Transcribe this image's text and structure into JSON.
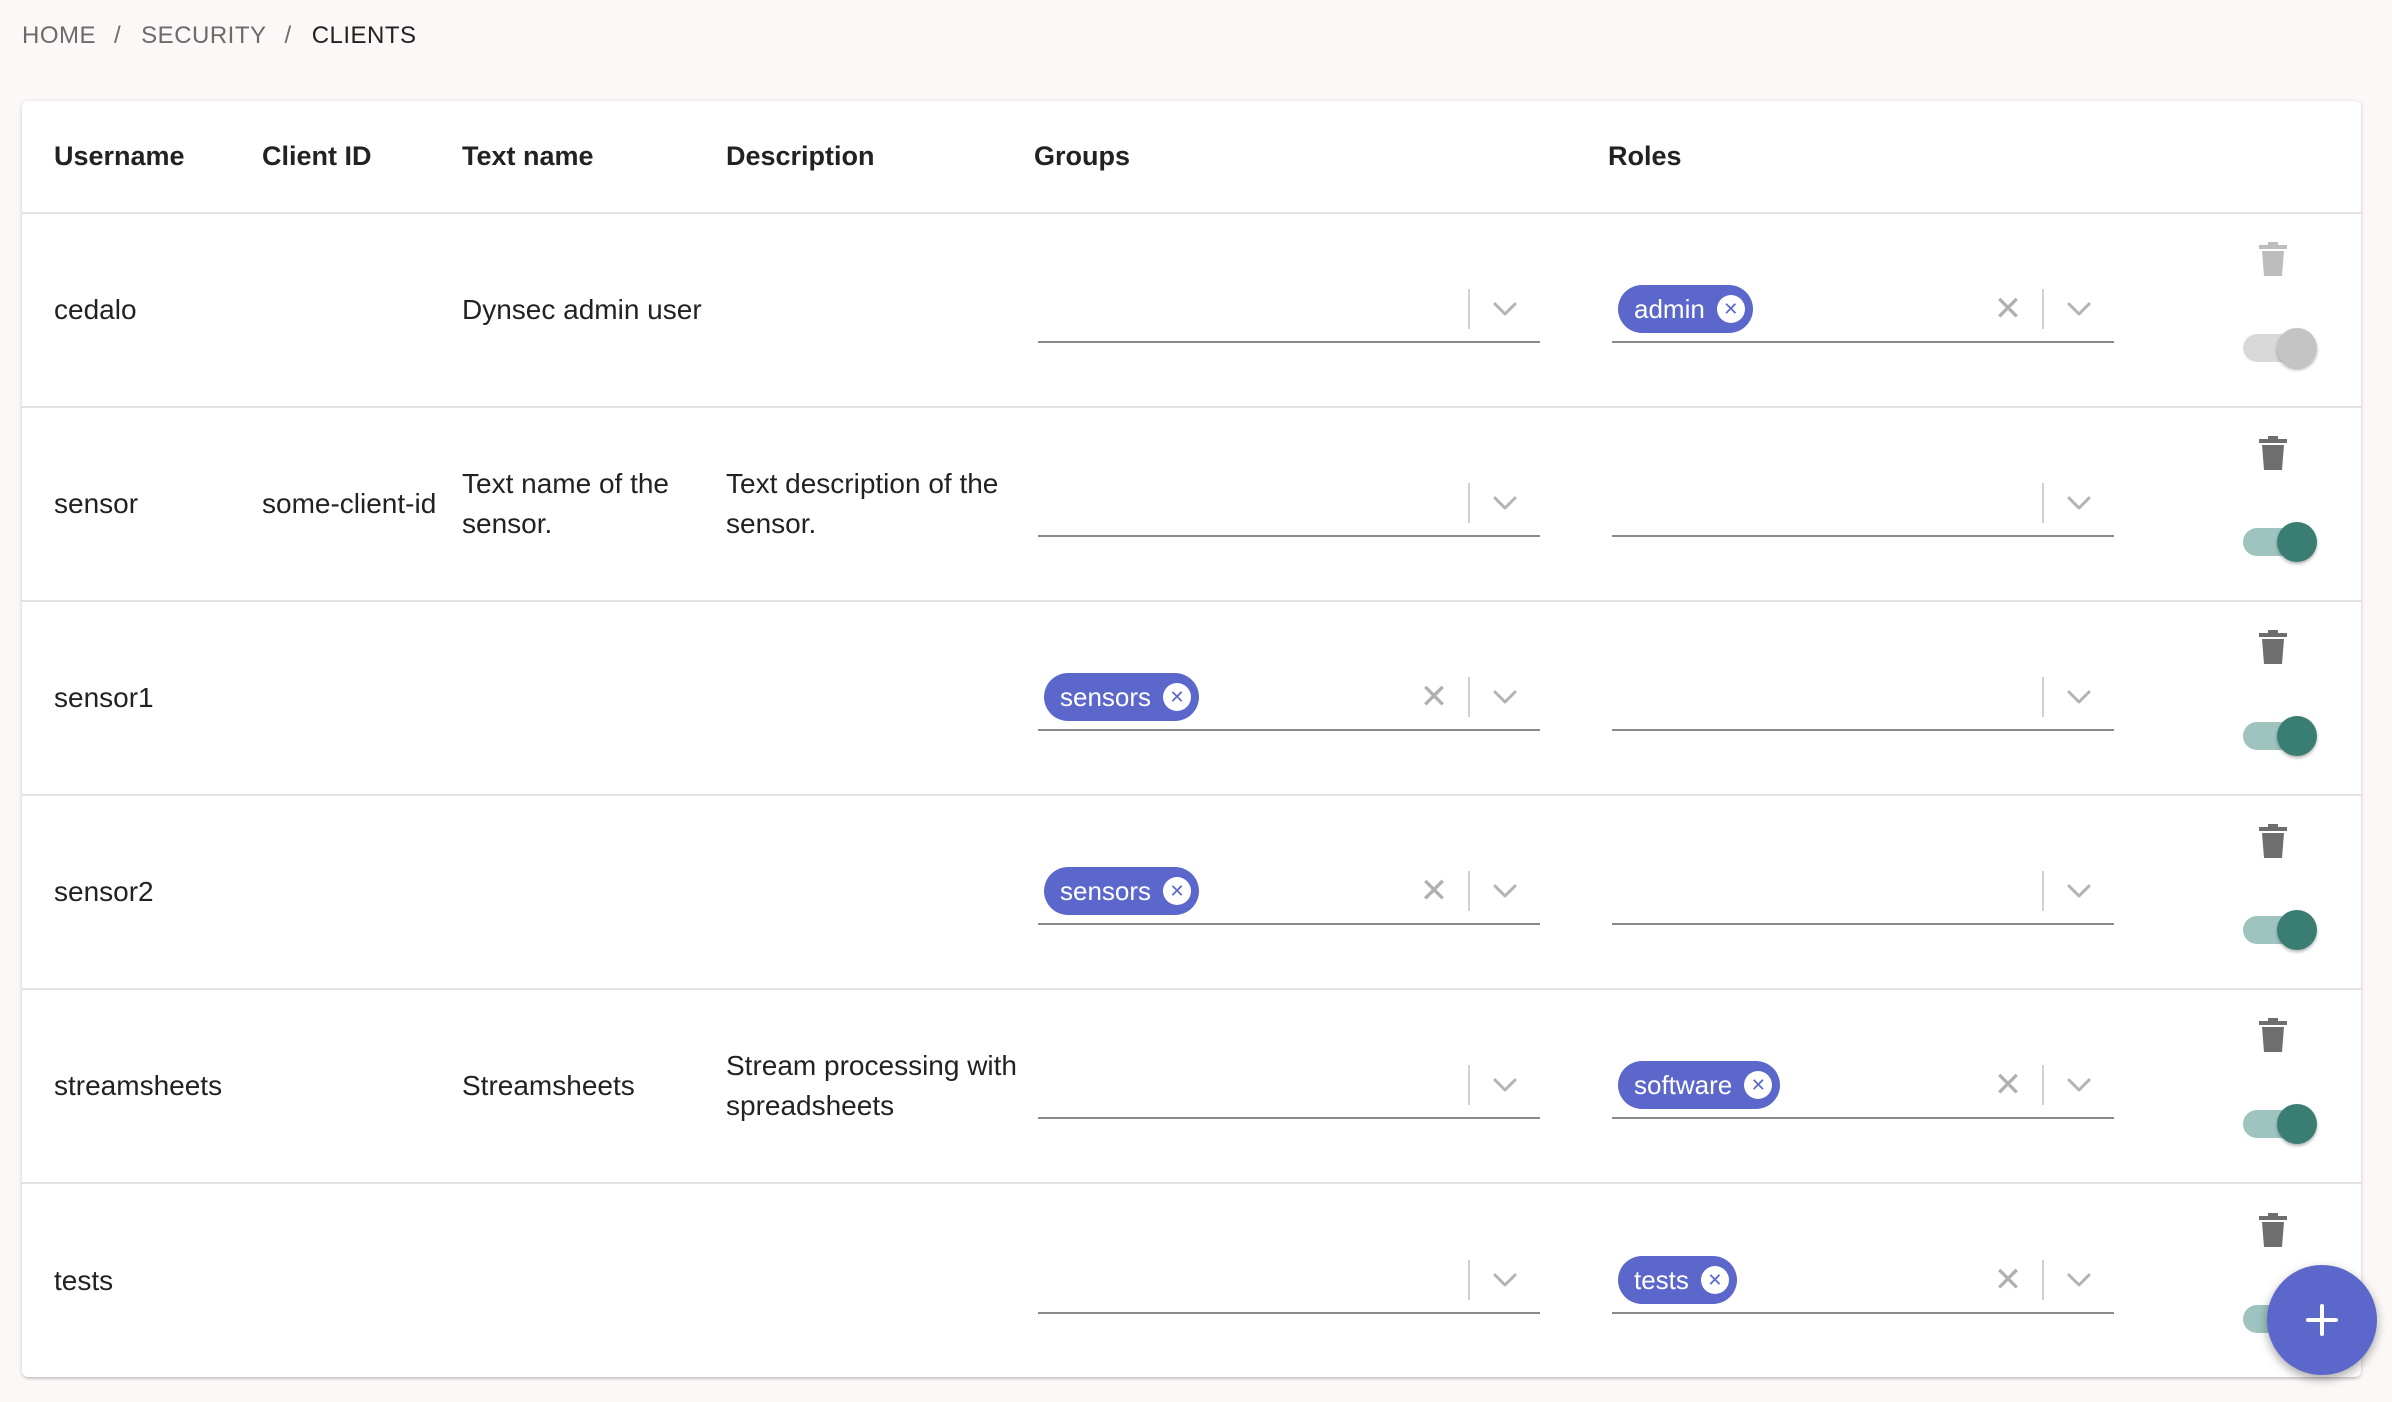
{
  "breadcrumb": {
    "home": "HOME",
    "security": "SECURITY",
    "current": "CLIENTS",
    "separator": "/"
  },
  "table": {
    "headers": {
      "username": "Username",
      "client_id": "Client ID",
      "text_name": "Text name",
      "description": "Description",
      "groups": "Groups",
      "roles": "Roles"
    },
    "rows": [
      {
        "username": "cedalo",
        "client_id": "",
        "text_name": "Dynsec admin user",
        "description": "",
        "groups": [],
        "roles": [
          "admin"
        ],
        "enabled": false
      },
      {
        "username": "sensor",
        "client_id": "some-client-id",
        "text_name": "Text name of the sensor.",
        "description": "Text description of the sensor.",
        "groups": [],
        "roles": [],
        "enabled": true
      },
      {
        "username": "sensor1",
        "client_id": "",
        "text_name": "",
        "description": "",
        "groups": [
          "sensors"
        ],
        "roles": [],
        "enabled": true
      },
      {
        "username": "sensor2",
        "client_id": "",
        "text_name": "",
        "description": "",
        "groups": [
          "sensors"
        ],
        "roles": [],
        "enabled": true
      },
      {
        "username": "streamsheets",
        "client_id": "",
        "text_name": "Streamsheets",
        "description": "Stream processing with spreadsheets",
        "groups": [],
        "roles": [
          "software"
        ],
        "enabled": true
      },
      {
        "username": "tests",
        "client_id": "",
        "text_name": "",
        "description": "",
        "groups": [],
        "roles": [
          "tests"
        ],
        "enabled": true
      }
    ]
  },
  "icons": {
    "chip_delete": "cancel-circle-icon",
    "clear": "close-icon",
    "expand": "chevron-down-icon",
    "delete": "trash-icon",
    "add": "plus-icon"
  },
  "colors": {
    "chip": "#5c67cc",
    "toggle_on": "#3a7d73",
    "toggle_track_on": "#9fc4bf",
    "fab": "#5c67cc"
  }
}
